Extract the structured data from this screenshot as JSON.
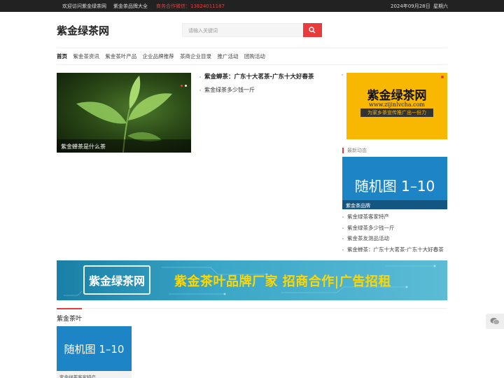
{
  "topbar": {
    "welcome": "欢迎访问紫金绿茶网",
    "brand_link": "紫金茶品牌大全",
    "contact": "商务合作微信：13824011187",
    "date": "2024年09月28日",
    "weekday": "星期六"
  },
  "header": {
    "logo": "紫金绿茶网",
    "search_placeholder": "请输入关键词"
  },
  "nav": {
    "items": [
      "首页",
      "紫金茶资讯",
      "紫金茶叶产品",
      "企业品牌推荐",
      "茶商企业目录",
      "推广活动",
      "团购活动"
    ]
  },
  "hero": {
    "caption": "紫金蝉茶是什么茶"
  },
  "headlines": [
    "紫金蝉茶：广东十大茗茶-广东十大好春茶",
    "紫金绿茶多少钱一斤"
  ],
  "side_ad": {
    "title": "紫金绿茶网",
    "url": "www.zijinlvcha.com",
    "slogan": "为家乡茶宣传推广出一份力"
  },
  "news": {
    "heading": "最新动态",
    "image_text": "随机图 1–10",
    "image_caption": "紫金茶品牌",
    "items": [
      "紫金绿茶客家特产",
      "紫金绿茶多少钱一斤",
      "紫金茶友测品活动",
      "紫金蝉茶：广东十大茗茶-广东十大好春茶"
    ]
  },
  "banner": {
    "logo": "紫金绿茶网",
    "slogan": "紫金茶叶品牌厂家 招商合作|广告招租"
  },
  "section": {
    "title": "紫金茶叶",
    "card_image_text": "随机图 1–10",
    "card_caption": "紫金绿茶客家特产"
  },
  "colors": {
    "accent": "#e83c3c",
    "topbar_bg": "#222222",
    "ad_yellow": "#f8b701",
    "image_blue": "#1d84c6"
  }
}
